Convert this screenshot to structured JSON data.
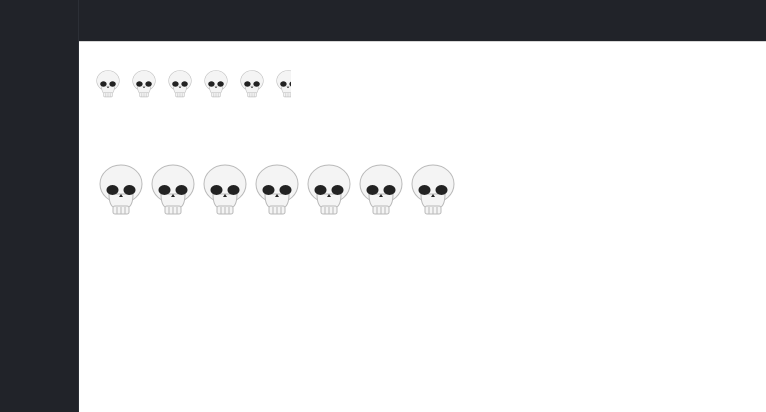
{
  "small_row": {
    "icons": [
      "skull-icon",
      "skull-icon",
      "skull-icon",
      "skull-icon",
      "skull-icon",
      "skull-icon"
    ]
  },
  "large_row": {
    "icons": [
      "skull-icon",
      "skull-icon",
      "skull-icon",
      "skull-icon",
      "skull-icon",
      "skull-icon",
      "skull-icon"
    ]
  },
  "colors": {
    "sidebar_bg": "#212329",
    "topbar_bg": "#212329",
    "content_bg": "#ffffff",
    "skull_light": "#f4f4f4",
    "skull_shadow": "#b9b9b9",
    "skull_eye": "#222222"
  }
}
